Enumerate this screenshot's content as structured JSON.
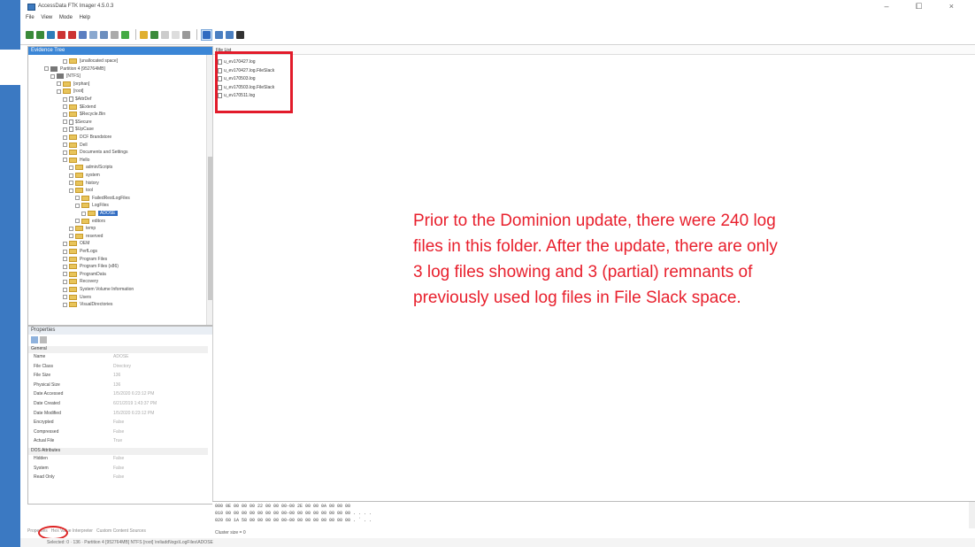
{
  "window": {
    "title": "AccessData FTK Imager 4.5.0.3",
    "controls": "–  ⧠  ×"
  },
  "menu": [
    "File",
    "View",
    "Mode",
    "Help"
  ],
  "evidence_tree": {
    "header": "Evidence Tree",
    "items": [
      {
        "label": "[unallocated space]",
        "indent": 5,
        "icon": "folder-icon",
        "selected": false
      },
      {
        "label": "Partition 4 [952764MB]",
        "indent": 2,
        "icon": "drive-icon",
        "selected": false
      },
      {
        "label": "[NTFS]",
        "indent": 3,
        "icon": "drive-icon",
        "selected": false
      },
      {
        "label": "[orphan]",
        "indent": 4,
        "icon": "folder-icon",
        "selected": false
      },
      {
        "label": "[root]",
        "indent": 4,
        "icon": "folder-icon",
        "selected": false
      },
      {
        "label": "$AttrDef",
        "indent": 5,
        "icon": "file-icon",
        "selected": false
      },
      {
        "label": "$Extend",
        "indent": 5,
        "icon": "folder-icon",
        "selected": false
      },
      {
        "label": "$Recycle.Bin",
        "indent": 5,
        "icon": "folder-icon",
        "selected": false
      },
      {
        "label": "$Secure",
        "indent": 5,
        "icon": "file-icon",
        "selected": false
      },
      {
        "label": "$UpCase",
        "indent": 5,
        "icon": "file-icon",
        "selected": false
      },
      {
        "label": "DCF Brandstore",
        "indent": 5,
        "icon": "folder-icon",
        "selected": false
      },
      {
        "label": "Dell",
        "indent": 5,
        "icon": "folder-icon",
        "selected": false
      },
      {
        "label": "Documents and Settings",
        "indent": 5,
        "icon": "folder-icon",
        "selected": false
      },
      {
        "label": "Hello",
        "indent": 5,
        "icon": "folder-icon",
        "selected": false
      },
      {
        "label": "admin/Scripts",
        "indent": 6,
        "icon": "folder-icon",
        "selected": false
      },
      {
        "label": "system",
        "indent": 6,
        "icon": "folder-icon",
        "selected": false
      },
      {
        "label": "history",
        "indent": 6,
        "icon": "folder-icon",
        "selected": false
      },
      {
        "label": "tool",
        "indent": 6,
        "icon": "folder-icon",
        "selected": false
      },
      {
        "label": "FailedRestLogFiles",
        "indent": 7,
        "icon": "folder-icon",
        "selected": false
      },
      {
        "label": "LogFiles",
        "indent": 7,
        "icon": "folder-icon",
        "selected": false
      },
      {
        "label": "ADOSE",
        "indent": 8,
        "icon": "folder-icon",
        "selected": true
      },
      {
        "label": "editors",
        "indent": 7,
        "icon": "folder-icon",
        "selected": false
      },
      {
        "label": "temp",
        "indent": 6,
        "icon": "folder-icon",
        "selected": false
      },
      {
        "label": "reserved",
        "indent": 6,
        "icon": "folder-icon",
        "selected": false
      },
      {
        "label": "OEM",
        "indent": 5,
        "icon": "folder-icon",
        "selected": false
      },
      {
        "label": "PerfLogs",
        "indent": 5,
        "icon": "folder-icon",
        "selected": false
      },
      {
        "label": "Program Files",
        "indent": 5,
        "icon": "folder-icon",
        "selected": false
      },
      {
        "label": "Program Files (x86)",
        "indent": 5,
        "icon": "folder-icon",
        "selected": false
      },
      {
        "label": "ProgramData",
        "indent": 5,
        "icon": "folder-icon",
        "selected": false
      },
      {
        "label": "Recovery",
        "indent": 5,
        "icon": "folder-icon",
        "selected": false
      },
      {
        "label": "System Volume Information",
        "indent": 5,
        "icon": "folder-icon",
        "selected": false
      },
      {
        "label": "Users",
        "indent": 5,
        "icon": "folder-icon",
        "selected": false
      },
      {
        "label": "VisualDirectories",
        "indent": 5,
        "icon": "folder-icon",
        "selected": false
      }
    ]
  },
  "properties": {
    "header": "Properties",
    "group_general": "General",
    "rows": [
      {
        "key": "Name",
        "value": "ADOSE"
      },
      {
        "key": "File Class",
        "value": "Directory"
      },
      {
        "key": "File Size",
        "value": "136"
      },
      {
        "key": "Physical Size",
        "value": "136"
      },
      {
        "key": "Date Accessed",
        "value": "1/5/2020 6:23:12 PM"
      },
      {
        "key": "Date Created",
        "value": "6/21/2019 1:43:37 PM"
      },
      {
        "key": "Date Modified",
        "value": "1/5/2020 6:23:12 PM"
      },
      {
        "key": "Encrypted",
        "value": "False"
      },
      {
        "key": "Compressed",
        "value": "False"
      },
      {
        "key": "Actual File",
        "value": "True"
      }
    ],
    "group_dos": "DOS Attributes",
    "dos_rows": [
      {
        "key": "Hidden",
        "value": "False"
      },
      {
        "key": "System",
        "value": "False"
      },
      {
        "key": "Read Only",
        "value": "False"
      }
    ]
  },
  "bottom_tabs": [
    "Properties",
    "Hex Value Interpreter",
    "Custom Content Sources"
  ],
  "file_list": {
    "header": "File List",
    "files": [
      "u_ev170427.log",
      "u_ev170427.log.FileSlack",
      "u_ev170503.log",
      "u_ev170503.log.FileSlack",
      "u_ev170511.log"
    ]
  },
  "annotation": {
    "line1": "Prior to the Dominion update, there were 240 log",
    "line2": "files in this folder. After the update, there are only",
    "line3": "3 log files showing and 3 (partial) remnants of",
    "line4": "previously used log files in File Slack space."
  },
  "hex": {
    "rows": [
      "000  0E 00 00 00 22 00 00 00-00 2E 00 00 0A 00 00 00",
      "010  00 00 00 00 00 00 00 00-00 00 00 00 00 00 00 00  . . . .",
      "020  60 1A 58 00 00 00 00 00-00 00 00 00 00 00 00 00  . ` .  ."
    ],
    "footer": "Cluster size = 0"
  },
  "status_bar": "Selected: 0 · 136 · Partition 4 [952764MB] NTFS [root] \\reliadd\\logs\\LogFiles\\ADOSE",
  "colors": {
    "accent_blue": "#3b86d6",
    "annotation_red": "#e8202d",
    "highlight_red": "#e21b2a"
  }
}
